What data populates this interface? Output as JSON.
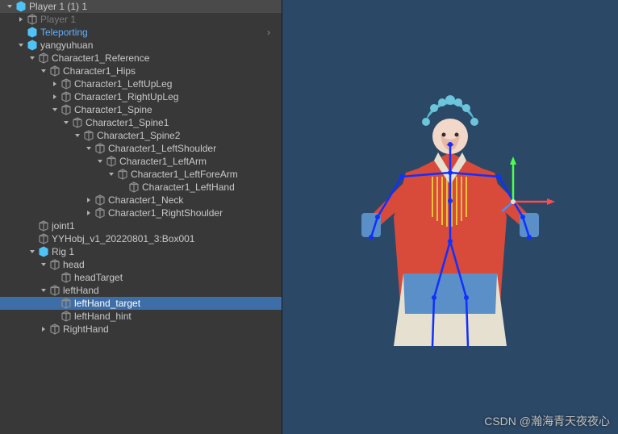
{
  "hierarchy": [
    {
      "indent": 0,
      "arrow": "down",
      "icon": "cube-b",
      "label": "Player 1 (1) 1"
    },
    {
      "indent": 1,
      "arrow": "right",
      "icon": "cube-g",
      "label": "Player 1",
      "greyed": true
    },
    {
      "indent": 1,
      "arrow": "none",
      "icon": "cube-b",
      "label": "Teleporting",
      "blue": true,
      "hasChevron": true
    },
    {
      "indent": 1,
      "arrow": "down",
      "icon": "cube-b",
      "label": "yangyuhuan"
    },
    {
      "indent": 2,
      "arrow": "down",
      "icon": "cube-g",
      "label": "Character1_Reference"
    },
    {
      "indent": 3,
      "arrow": "down",
      "icon": "cube-g",
      "label": "Character1_Hips"
    },
    {
      "indent": 4,
      "arrow": "right",
      "icon": "cube-g",
      "label": "Character1_LeftUpLeg"
    },
    {
      "indent": 4,
      "arrow": "right",
      "icon": "cube-g",
      "label": "Character1_RightUpLeg"
    },
    {
      "indent": 4,
      "arrow": "down",
      "icon": "cube-g",
      "label": "Character1_Spine"
    },
    {
      "indent": 5,
      "arrow": "down",
      "icon": "cube-g",
      "label": "Character1_Spine1"
    },
    {
      "indent": 6,
      "arrow": "down",
      "icon": "cube-g",
      "label": "Character1_Spine2"
    },
    {
      "indent": 7,
      "arrow": "down",
      "icon": "cube-g",
      "label": "Character1_LeftShoulder"
    },
    {
      "indent": 8,
      "arrow": "down",
      "icon": "cube-g",
      "label": "Character1_LeftArm"
    },
    {
      "indent": 9,
      "arrow": "down",
      "icon": "cube-g",
      "label": "Character1_LeftForeArm"
    },
    {
      "indent": 10,
      "arrow": "none",
      "icon": "cube-g",
      "label": "Character1_LeftHand"
    },
    {
      "indent": 7,
      "arrow": "right",
      "icon": "cube-g",
      "label": "Character1_Neck"
    },
    {
      "indent": 7,
      "arrow": "right",
      "icon": "cube-g",
      "label": "Character1_RightShoulder"
    },
    {
      "indent": 2,
      "arrow": "none",
      "icon": "cube-g",
      "label": "joint1"
    },
    {
      "indent": 2,
      "arrow": "none",
      "icon": "cube-g",
      "label": "YYHobj_v1_20220801_3:Box001"
    },
    {
      "indent": 2,
      "arrow": "down",
      "icon": "cube-b",
      "label": "Rig 1"
    },
    {
      "indent": 3,
      "arrow": "down",
      "icon": "cube-g",
      "label": "head"
    },
    {
      "indent": 4,
      "arrow": "none",
      "icon": "cube-g",
      "label": "headTarget"
    },
    {
      "indent": 3,
      "arrow": "down",
      "icon": "cube-g",
      "label": "leftHand"
    },
    {
      "indent": 4,
      "arrow": "none",
      "icon": "cube-g",
      "label": "leftHand_target",
      "selected": true
    },
    {
      "indent": 4,
      "arrow": "none",
      "icon": "cube-g",
      "label": "leftHand_hint"
    },
    {
      "indent": 3,
      "arrow": "right",
      "icon": "cube-g",
      "label": "RightHand"
    }
  ],
  "watermark": "CSDN @瀚海青天夜夜心"
}
